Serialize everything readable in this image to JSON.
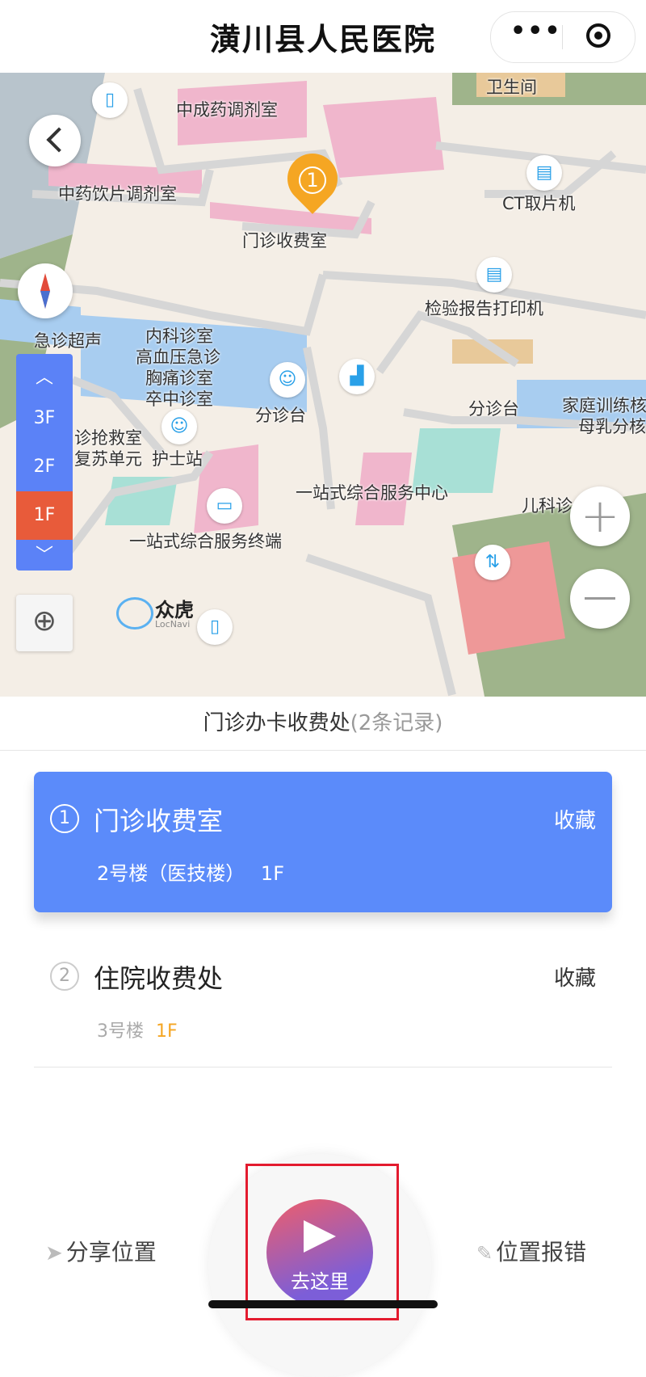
{
  "header": {
    "title": "潢川县人民医院",
    "menu_icon": "more-dots-icon",
    "close_icon": "target-circle-icon"
  },
  "map": {
    "labels": [
      "卫生间",
      "中成药调剂室",
      "中药饮片调剂室",
      "CT取片机",
      "门诊收费室",
      "检验报告打印机",
      "急诊超声",
      "内科诊室",
      "高血压急诊",
      "胸痛诊室",
      "卒中诊室",
      "分诊台",
      "分诊台",
      "家庭训练核",
      "母乳分核",
      "诊抢救室",
      "复苏单元",
      "护士站",
      "一站式综合服务中心",
      "儿科诊",
      "一站式综合服务终端"
    ],
    "pin_number": "1",
    "floors": [
      "3F",
      "2F",
      "1F"
    ],
    "selected_floor": "1F",
    "logo": {
      "name": "众虎",
      "sub": "LocNavi"
    }
  },
  "results": {
    "title": "门诊办卡收费处",
    "count": "(2条记录)",
    "items": [
      {
        "num": "1",
        "name": "门诊收费室",
        "fav": "收藏",
        "building": "2号楼（医技楼）",
        "floor": "1F",
        "selected": true
      },
      {
        "num": "2",
        "name": "住院收费处",
        "fav": "收藏",
        "building": "3号楼",
        "floor": "1F",
        "selected": false
      }
    ]
  },
  "actions": {
    "share": "分享位置",
    "go": "去这里",
    "report": "位置报错"
  },
  "colors": {
    "accent": "#5b8bfa",
    "floor_selected": "#e85b3a",
    "pin": "#f5a623",
    "highlight": "#e31b2f"
  }
}
